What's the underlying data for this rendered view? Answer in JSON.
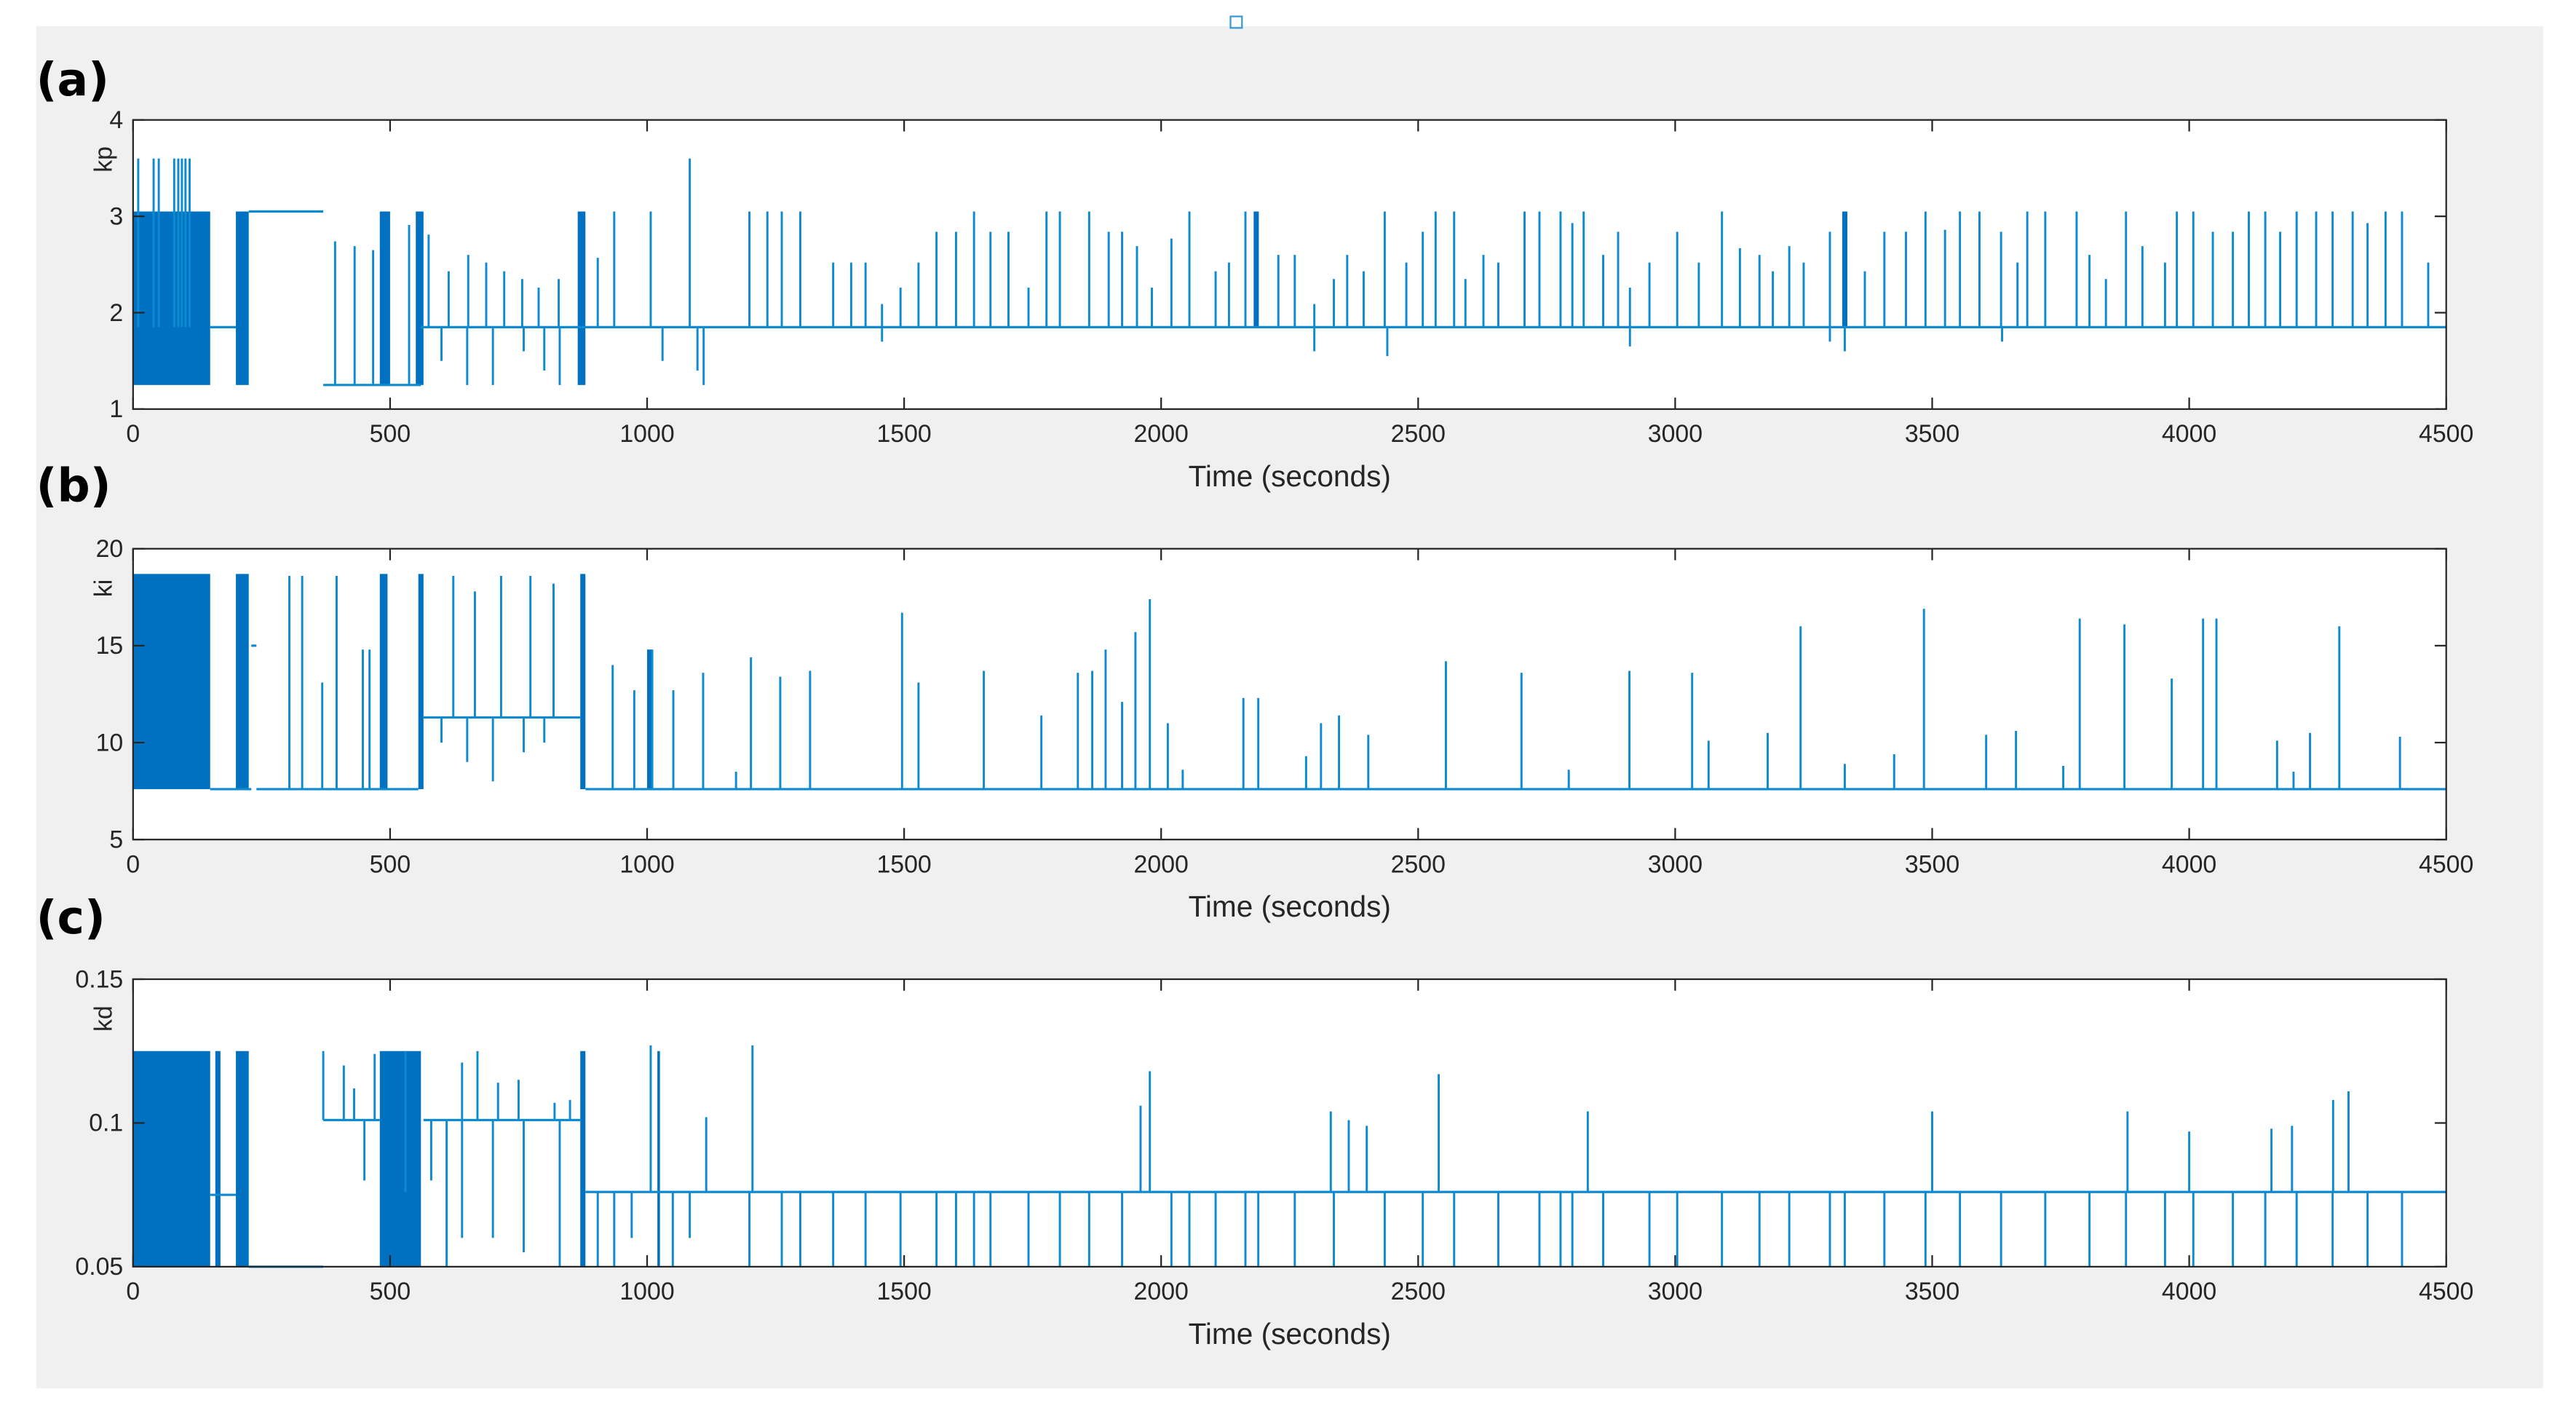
{
  "colors": {
    "line": "#0e8ad0",
    "dense": "#0070c0",
    "axis": "#262626",
    "figure_bg": "#f0f0f0"
  },
  "chart_data": [
    {
      "type": "line",
      "panel_label": "(a)",
      "ylabel": "kp",
      "xlabel": "Time (seconds)",
      "xlim": [
        0,
        4500
      ],
      "ylim": [
        1,
        4
      ],
      "xticks": [
        "0",
        "500",
        "1000",
        "1500",
        "2000",
        "2500",
        "3000",
        "3500",
        "4000",
        "4500"
      ],
      "yticks": [
        "1",
        "2",
        "3",
        "4"
      ],
      "ytick_values": [
        1,
        2,
        3,
        4
      ],
      "baseline_segments": [
        [
          150,
          200,
          1.85
        ],
        [
          225,
          370,
          3.05
        ],
        [
          370,
          560,
          1.25
        ],
        [
          560,
          4500,
          1.85
        ]
      ],
      "bands": [
        [
          0,
          150,
          1.25,
          3.05
        ],
        [
          200,
          225,
          1.25,
          3.05
        ],
        [
          480,
          500,
          1.25,
          3.05
        ],
        [
          550,
          565,
          1.25,
          3.05
        ],
        [
          865,
          880,
          1.25,
          3.05
        ],
        [
          2180,
          2190,
          1.85,
          3.05
        ],
        [
          3325,
          3335,
          1.85,
          3.05
        ]
      ],
      "spikes": [
        [
          10,
          3.6
        ],
        [
          40,
          3.6
        ],
        [
          50,
          3.6
        ],
        [
          80,
          3.6
        ],
        [
          88,
          3.6
        ],
        [
          95,
          3.6
        ],
        [
          102,
          3.6
        ],
        [
          110,
          3.6
        ],
        [
          393,
          2.74
        ],
        [
          431,
          2.69
        ],
        [
          467,
          2.65
        ],
        [
          537,
          2.91
        ],
        [
          575,
          2.81
        ],
        [
          614,
          2.43
        ],
        [
          652,
          2.6
        ],
        [
          687,
          2.52
        ],
        [
          722,
          2.43
        ],
        [
          757,
          2.35
        ],
        [
          789,
          2.26
        ],
        [
          828,
          2.35
        ],
        [
          904,
          2.57
        ],
        [
          936,
          3.05
        ],
        [
          1007,
          3.05
        ],
        [
          1083,
          3.6
        ],
        [
          1199,
          3.05
        ],
        [
          1234,
          3.05
        ],
        [
          1262,
          3.05
        ],
        [
          1298,
          3.05
        ],
        [
          1362,
          2.52
        ],
        [
          1397,
          2.52
        ],
        [
          1425,
          2.52
        ],
        [
          1457,
          2.09
        ],
        [
          1493,
          2.26
        ],
        [
          1528,
          2.52
        ],
        [
          1563,
          2.84
        ],
        [
          1601,
          2.84
        ],
        [
          1636,
          3.05
        ],
        [
          1668,
          2.84
        ],
        [
          1703,
          2.84
        ],
        [
          1742,
          2.26
        ],
        [
          1777,
          3.05
        ],
        [
          1803,
          3.05
        ],
        [
          1860,
          3.05
        ],
        [
          1898,
          2.84
        ],
        [
          1924,
          2.84
        ],
        [
          1953,
          2.69
        ],
        [
          1982,
          2.26
        ],
        [
          2020,
          2.77
        ],
        [
          2055,
          3.05
        ],
        [
          2106,
          2.43
        ],
        [
          2132,
          2.52
        ],
        [
          2164,
          3.05
        ],
        [
          2228,
          2.6
        ],
        [
          2260,
          2.6
        ],
        [
          2298,
          2.09
        ],
        [
          2336,
          2.35
        ],
        [
          2362,
          2.6
        ],
        [
          2394,
          2.43
        ],
        [
          2435,
          3.05
        ],
        [
          2477,
          2.52
        ],
        [
          2509,
          2.84
        ],
        [
          2534,
          3.05
        ],
        [
          2570,
          3.05
        ],
        [
          2592,
          2.35
        ],
        [
          2627,
          2.6
        ],
        [
          2656,
          2.52
        ],
        [
          2707,
          3.05
        ],
        [
          2736,
          3.05
        ],
        [
          2777,
          3.05
        ],
        [
          2800,
          2.93
        ],
        [
          2822,
          3.05
        ],
        [
          2860,
          2.6
        ],
        [
          2889,
          2.84
        ],
        [
          2912,
          2.26
        ],
        [
          2950,
          2.52
        ],
        [
          3004,
          2.84
        ],
        [
          3046,
          2.52
        ],
        [
          3091,
          3.05
        ],
        [
          3126,
          2.67
        ],
        [
          3164,
          2.6
        ],
        [
          3190,
          2.43
        ],
        [
          3222,
          2.69
        ],
        [
          3250,
          2.52
        ],
        [
          3301,
          2.84
        ],
        [
          3369,
          2.43
        ],
        [
          3407,
          2.84
        ],
        [
          3449,
          2.84
        ],
        [
          3487,
          3.05
        ],
        [
          3525,
          2.86
        ],
        [
          3554,
          3.05
        ],
        [
          3592,
          3.05
        ],
        [
          3634,
          2.84
        ],
        [
          3666,
          2.52
        ],
        [
          3685,
          3.05
        ],
        [
          3720,
          3.05
        ],
        [
          3781,
          3.05
        ],
        [
          3806,
          2.6
        ],
        [
          3838,
          2.35
        ],
        [
          3877,
          3.05
        ],
        [
          3909,
          2.69
        ],
        [
          3953,
          2.52
        ],
        [
          3976,
          3.05
        ],
        [
          4008,
          3.05
        ],
        [
          4046,
          2.84
        ],
        [
          4085,
          2.84
        ],
        [
          4116,
          3.05
        ],
        [
          4148,
          3.05
        ],
        [
          4177,
          2.84
        ],
        [
          4209,
          3.05
        ],
        [
          4247,
          3.05
        ],
        [
          4279,
          3.05
        ],
        [
          4318,
          3.05
        ],
        [
          4347,
          2.93
        ],
        [
          4382,
          3.05
        ],
        [
          4414,
          3.05
        ],
        [
          4465,
          2.52
        ]
      ],
      "down_spikes": [
        [
          600,
          1.5
        ],
        [
          650,
          1.25
        ],
        [
          700,
          1.25
        ],
        [
          760,
          1.6
        ],
        [
          800,
          1.4
        ],
        [
          830,
          1.25
        ],
        [
          1030,
          1.5
        ],
        [
          1098,
          1.4
        ],
        [
          1110,
          1.25
        ],
        [
          1457,
          1.7
        ],
        [
          2298,
          1.6
        ],
        [
          2440,
          1.55
        ],
        [
          2912,
          1.65
        ],
        [
          3301,
          1.7
        ],
        [
          3330,
          1.6
        ],
        [
          3636,
          1.7
        ]
      ]
    },
    {
      "type": "line",
      "panel_label": "(b)",
      "ylabel": "ki",
      "xlabel": "Time (seconds)",
      "xlim": [
        0,
        4500
      ],
      "ylim": [
        5,
        20
      ],
      "xticks": [
        "0",
        "500",
        "1000",
        "1500",
        "2000",
        "2500",
        "3000",
        "3500",
        "4000",
        "4500"
      ],
      "yticks": [
        "5",
        "10",
        "15",
        "20"
      ],
      "ytick_values": [
        5,
        10,
        15,
        20
      ],
      "baseline_segments": [
        [
          150,
          230,
          7.6
        ],
        [
          230,
          240,
          15
        ],
        [
          240,
          555,
          7.6
        ],
        [
          565,
          870,
          11.3
        ],
        [
          880,
          4500,
          7.6
        ]
      ],
      "bands": [
        [
          0,
          150,
          7.6,
          18.7
        ],
        [
          200,
          225,
          7.6,
          18.7
        ],
        [
          480,
          495,
          7.6,
          18.7
        ],
        [
          555,
          565,
          7.6,
          18.7
        ],
        [
          870,
          880,
          7.6,
          18.7
        ],
        [
          1000,
          1010,
          7.6,
          14.8
        ]
      ],
      "spikes": [
        [
          304,
          18.6
        ],
        [
          329,
          18.6
        ],
        [
          368,
          13.1
        ],
        [
          396,
          18.6
        ],
        [
          447,
          14.8
        ],
        [
          460,
          14.8
        ],
        [
          623,
          18.6
        ],
        [
          665,
          17.8
        ],
        [
          716,
          18.6
        ],
        [
          773,
          18.6
        ],
        [
          818,
          18.2
        ],
        [
          933,
          14
        ],
        [
          975,
          12.7
        ],
        [
          1010,
          14.8
        ],
        [
          1051,
          12.7
        ],
        [
          1109,
          13.6
        ],
        [
          1173,
          8.5
        ],
        [
          1202,
          14.4
        ],
        [
          1259,
          13.4
        ],
        [
          1317,
          13.7
        ],
        [
          1496,
          16.7
        ],
        [
          1528,
          13.1
        ],
        [
          1655,
          13.7
        ],
        [
          1767,
          11.4
        ],
        [
          1838,
          13.6
        ],
        [
          1866,
          13.7
        ],
        [
          1892,
          14.8
        ],
        [
          1924,
          12.1
        ],
        [
          1950,
          15.7
        ],
        [
          1978,
          17.4
        ],
        [
          2013,
          11
        ],
        [
          2042,
          8.6
        ],
        [
          2160,
          12.3
        ],
        [
          2189,
          12.3
        ],
        [
          2282,
          9.3
        ],
        [
          2311,
          11
        ],
        [
          2346,
          11.4
        ],
        [
          2403,
          10.4
        ],
        [
          2554,
          14.2
        ],
        [
          2701,
          13.6
        ],
        [
          2793,
          8.6
        ],
        [
          2911,
          13.7
        ],
        [
          3033,
          13.6
        ],
        [
          3065,
          10.1
        ],
        [
          3180,
          10.5
        ],
        [
          3244,
          16
        ],
        [
          3330,
          8.9
        ],
        [
          3426,
          9.4
        ],
        [
          3484,
          16.9
        ],
        [
          3605,
          10.4
        ],
        [
          3663,
          10.6
        ],
        [
          3755,
          8.8
        ],
        [
          3787,
          16.4
        ],
        [
          3874,
          16.1
        ],
        [
          3966,
          13.3
        ],
        [
          4027,
          16.4
        ],
        [
          4053,
          16.4
        ],
        [
          4171,
          10.1
        ],
        [
          4203,
          8.5
        ],
        [
          4235,
          10.5
        ],
        [
          4292,
          16
        ],
        [
          4410,
          10.3
        ]
      ],
      "down_spikes": [
        [
          600,
          10
        ],
        [
          650,
          9
        ],
        [
          700,
          8
        ],
        [
          760,
          9.5
        ],
        [
          800,
          10
        ]
      ]
    },
    {
      "type": "line",
      "panel_label": "(c)",
      "ylabel": "kd",
      "xlabel": "Time (seconds)",
      "xlim": [
        0,
        4500
      ],
      "ylim": [
        0.05,
        0.15
      ],
      "xticks": [
        "0",
        "500",
        "1000",
        "1500",
        "2000",
        "2500",
        "3000",
        "3500",
        "4000",
        "4500"
      ],
      "yticks": [
        "0.05",
        "0.1",
        "0.15"
      ],
      "ytick_values": [
        0.05,
        0.1,
        0.15
      ],
      "baseline_segments": [
        [
          150,
          200,
          0.075
        ],
        [
          225,
          370,
          0.05
        ],
        [
          370,
          480,
          0.101
        ],
        [
          565,
          870,
          0.101
        ],
        [
          880,
          4500,
          0.076
        ]
      ],
      "bands": [
        [
          0,
          150,
          0.05,
          0.125
        ],
        [
          160,
          170,
          0.05,
          0.125
        ],
        [
          200,
          225,
          0.05,
          0.125
        ],
        [
          480,
          560,
          0.05,
          0.125
        ],
        [
          870,
          880,
          0.05,
          0.125
        ],
        [
          1020,
          1025,
          0.05,
          0.125
        ]
      ],
      "spikes": [
        [
          370,
          0.125
        ],
        [
          410,
          0.12
        ],
        [
          430,
          0.112
        ],
        [
          470,
          0.124
        ],
        [
          530,
          0.125
        ],
        [
          640,
          0.121
        ],
        [
          670,
          0.125
        ],
        [
          710,
          0.114
        ],
        [
          750,
          0.115
        ],
        [
          820,
          0.107
        ],
        [
          850,
          0.108
        ],
        [
          1007,
          0.127
        ],
        [
          1115,
          0.102
        ],
        [
          1205,
          0.127
        ],
        [
          1960,
          0.106
        ],
        [
          1978,
          0.118
        ],
        [
          2330,
          0.104
        ],
        [
          2365,
          0.101
        ],
        [
          2400,
          0.099
        ],
        [
          2540,
          0.117
        ],
        [
          2830,
          0.104
        ],
        [
          3500,
          0.104
        ],
        [
          3880,
          0.104
        ],
        [
          4000,
          0.097
        ],
        [
          4160,
          0.098
        ],
        [
          4200,
          0.099
        ],
        [
          4280,
          0.108
        ],
        [
          4310,
          0.111
        ]
      ],
      "down_spikes": [
        [
          240,
          0.05
        ],
        [
          330,
          0.05
        ],
        [
          450,
          0.08
        ],
        [
          580,
          0.08
        ],
        [
          610,
          0.05
        ],
        [
          640,
          0.06
        ],
        [
          700,
          0.06
        ],
        [
          760,
          0.055
        ],
        [
          830,
          0.05
        ],
        [
          904,
          0.05
        ],
        [
          936,
          0.05
        ],
        [
          970,
          0.06
        ],
        [
          1050,
          0.05
        ],
        [
          1083,
          0.06
        ],
        [
          1199,
          0.05
        ],
        [
          1262,
          0.05
        ],
        [
          1298,
          0.05
        ],
        [
          1362,
          0.05
        ],
        [
          1425,
          0.05
        ],
        [
          1493,
          0.05
        ],
        [
          1563,
          0.05
        ],
        [
          1601,
          0.05
        ],
        [
          1636,
          0.05
        ],
        [
          1668,
          0.05
        ],
        [
          1742,
          0.05
        ],
        [
          1803,
          0.05
        ],
        [
          1860,
          0.05
        ],
        [
          1924,
          0.05
        ],
        [
          2020,
          0.05
        ],
        [
          2055,
          0.05
        ],
        [
          2106,
          0.05
        ],
        [
          2164,
          0.05
        ],
        [
          2189,
          0.05
        ],
        [
          2260,
          0.05
        ],
        [
          2336,
          0.05
        ],
        [
          2435,
          0.05
        ],
        [
          2509,
          0.05
        ],
        [
          2570,
          0.05
        ],
        [
          2656,
          0.05
        ],
        [
          2736,
          0.05
        ],
        [
          2777,
          0.05
        ],
        [
          2800,
          0.05
        ],
        [
          2860,
          0.05
        ],
        [
          2950,
          0.05
        ],
        [
          3004,
          0.05
        ],
        [
          3091,
          0.05
        ],
        [
          3164,
          0.05
        ],
        [
          3222,
          0.05
        ],
        [
          3301,
          0.05
        ],
        [
          3330,
          0.05
        ],
        [
          3407,
          0.05
        ],
        [
          3487,
          0.05
        ],
        [
          3554,
          0.05
        ],
        [
          3634,
          0.05
        ],
        [
          3720,
          0.05
        ],
        [
          3806,
          0.05
        ],
        [
          3877,
          0.05
        ],
        [
          3953,
          0.05
        ],
        [
          4008,
          0.05
        ],
        [
          4085,
          0.05
        ],
        [
          4148,
          0.05
        ],
        [
          4209,
          0.05
        ],
        [
          4279,
          0.05
        ],
        [
          4347,
          0.05
        ],
        [
          4414,
          0.05
        ]
      ]
    }
  ]
}
